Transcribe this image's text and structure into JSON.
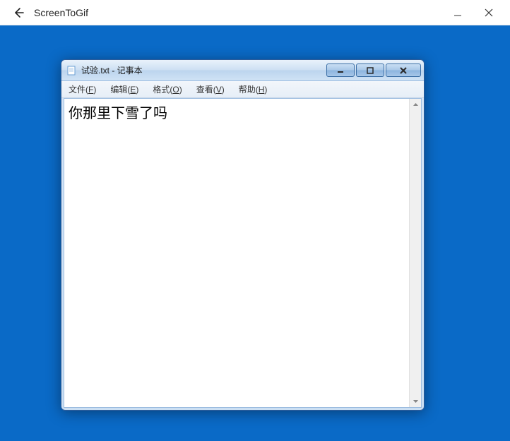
{
  "outer": {
    "title": "ScreenToGif"
  },
  "notepad": {
    "title": "试验.txt - 记事本",
    "menu": {
      "file": "文件(F)",
      "edit": "编辑(E)",
      "format": "格式(O)",
      "view": "查看(V)",
      "help": "帮助(H)"
    },
    "content": "你那里下雪了吗"
  }
}
